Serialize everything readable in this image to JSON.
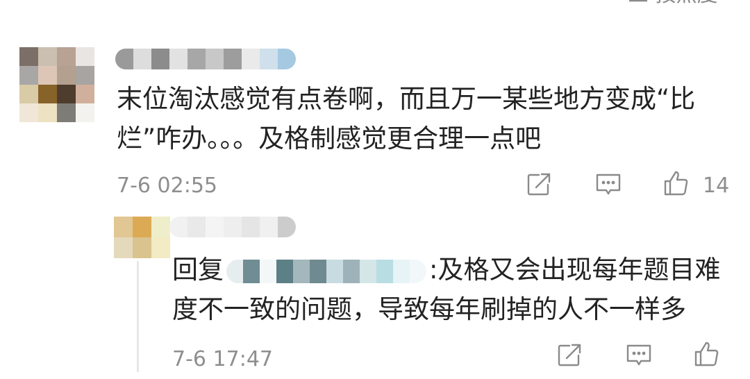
{
  "header": {
    "sort_label": "三 按热度"
  },
  "comment": {
    "avatar_colors": [
      "#7c6f67",
      "#cbbfb1",
      "#b7a294",
      "#e9e5e2",
      "#a9a7a6",
      "#ddc6b6",
      "#b3a08f",
      "#a7a4a2",
      "#d8cba6",
      "#876229",
      "#4e3d2d",
      "#d0b09d",
      "#f1e7d8",
      "#ede2c2",
      "#7e7c76",
      "#f4f2ef"
    ],
    "name_colors": [
      "#9a9a9a",
      "#dddddd",
      "#8c8c8c",
      "#e2e2e2",
      "#a7a7a7",
      "#c8c8c8",
      "#9d9d9d",
      "#eaeaea",
      "#cfe0ec",
      "#a6c9e2"
    ],
    "text": "末位淘汰感觉有点卷啊，而且万一某些地方变成“比烂”咋办。。。及格制感觉更合理一点吧",
    "time": "7-6 02:55",
    "like_count": "14"
  },
  "reply": {
    "avatar_colors": [
      "#e1c793",
      "#dcaa55",
      "#eeeecb",
      "#e4d9bb",
      "#d9c48f",
      "#f2ebc3"
    ],
    "name_colors": [
      "#f1f1f1",
      "#e9e9e9",
      "#f4f4f4",
      "#eeeeee",
      "#e5e5e5",
      "#f0f0f0",
      "#cccccc"
    ],
    "prefix": "回复",
    "inline_name_colors": [
      "#e6edef",
      "#6f8d93",
      "#f3f7f8",
      "#5d7f86",
      "#a3b7bc",
      "#6f8a90",
      "#c8dbe0",
      "#9eb3b9",
      "#d5e6e9",
      "#b8dde3",
      "#e6f4f6",
      "#f2f8fa"
    ],
    "text": ":及格又会出现每年题目难度不一致的问题，导致每年刷掉的人不一样多",
    "time": "7-6 17:47"
  },
  "icons": {
    "share": "share-icon",
    "comment": "comment-icon",
    "like": "thumbs-up-icon"
  }
}
